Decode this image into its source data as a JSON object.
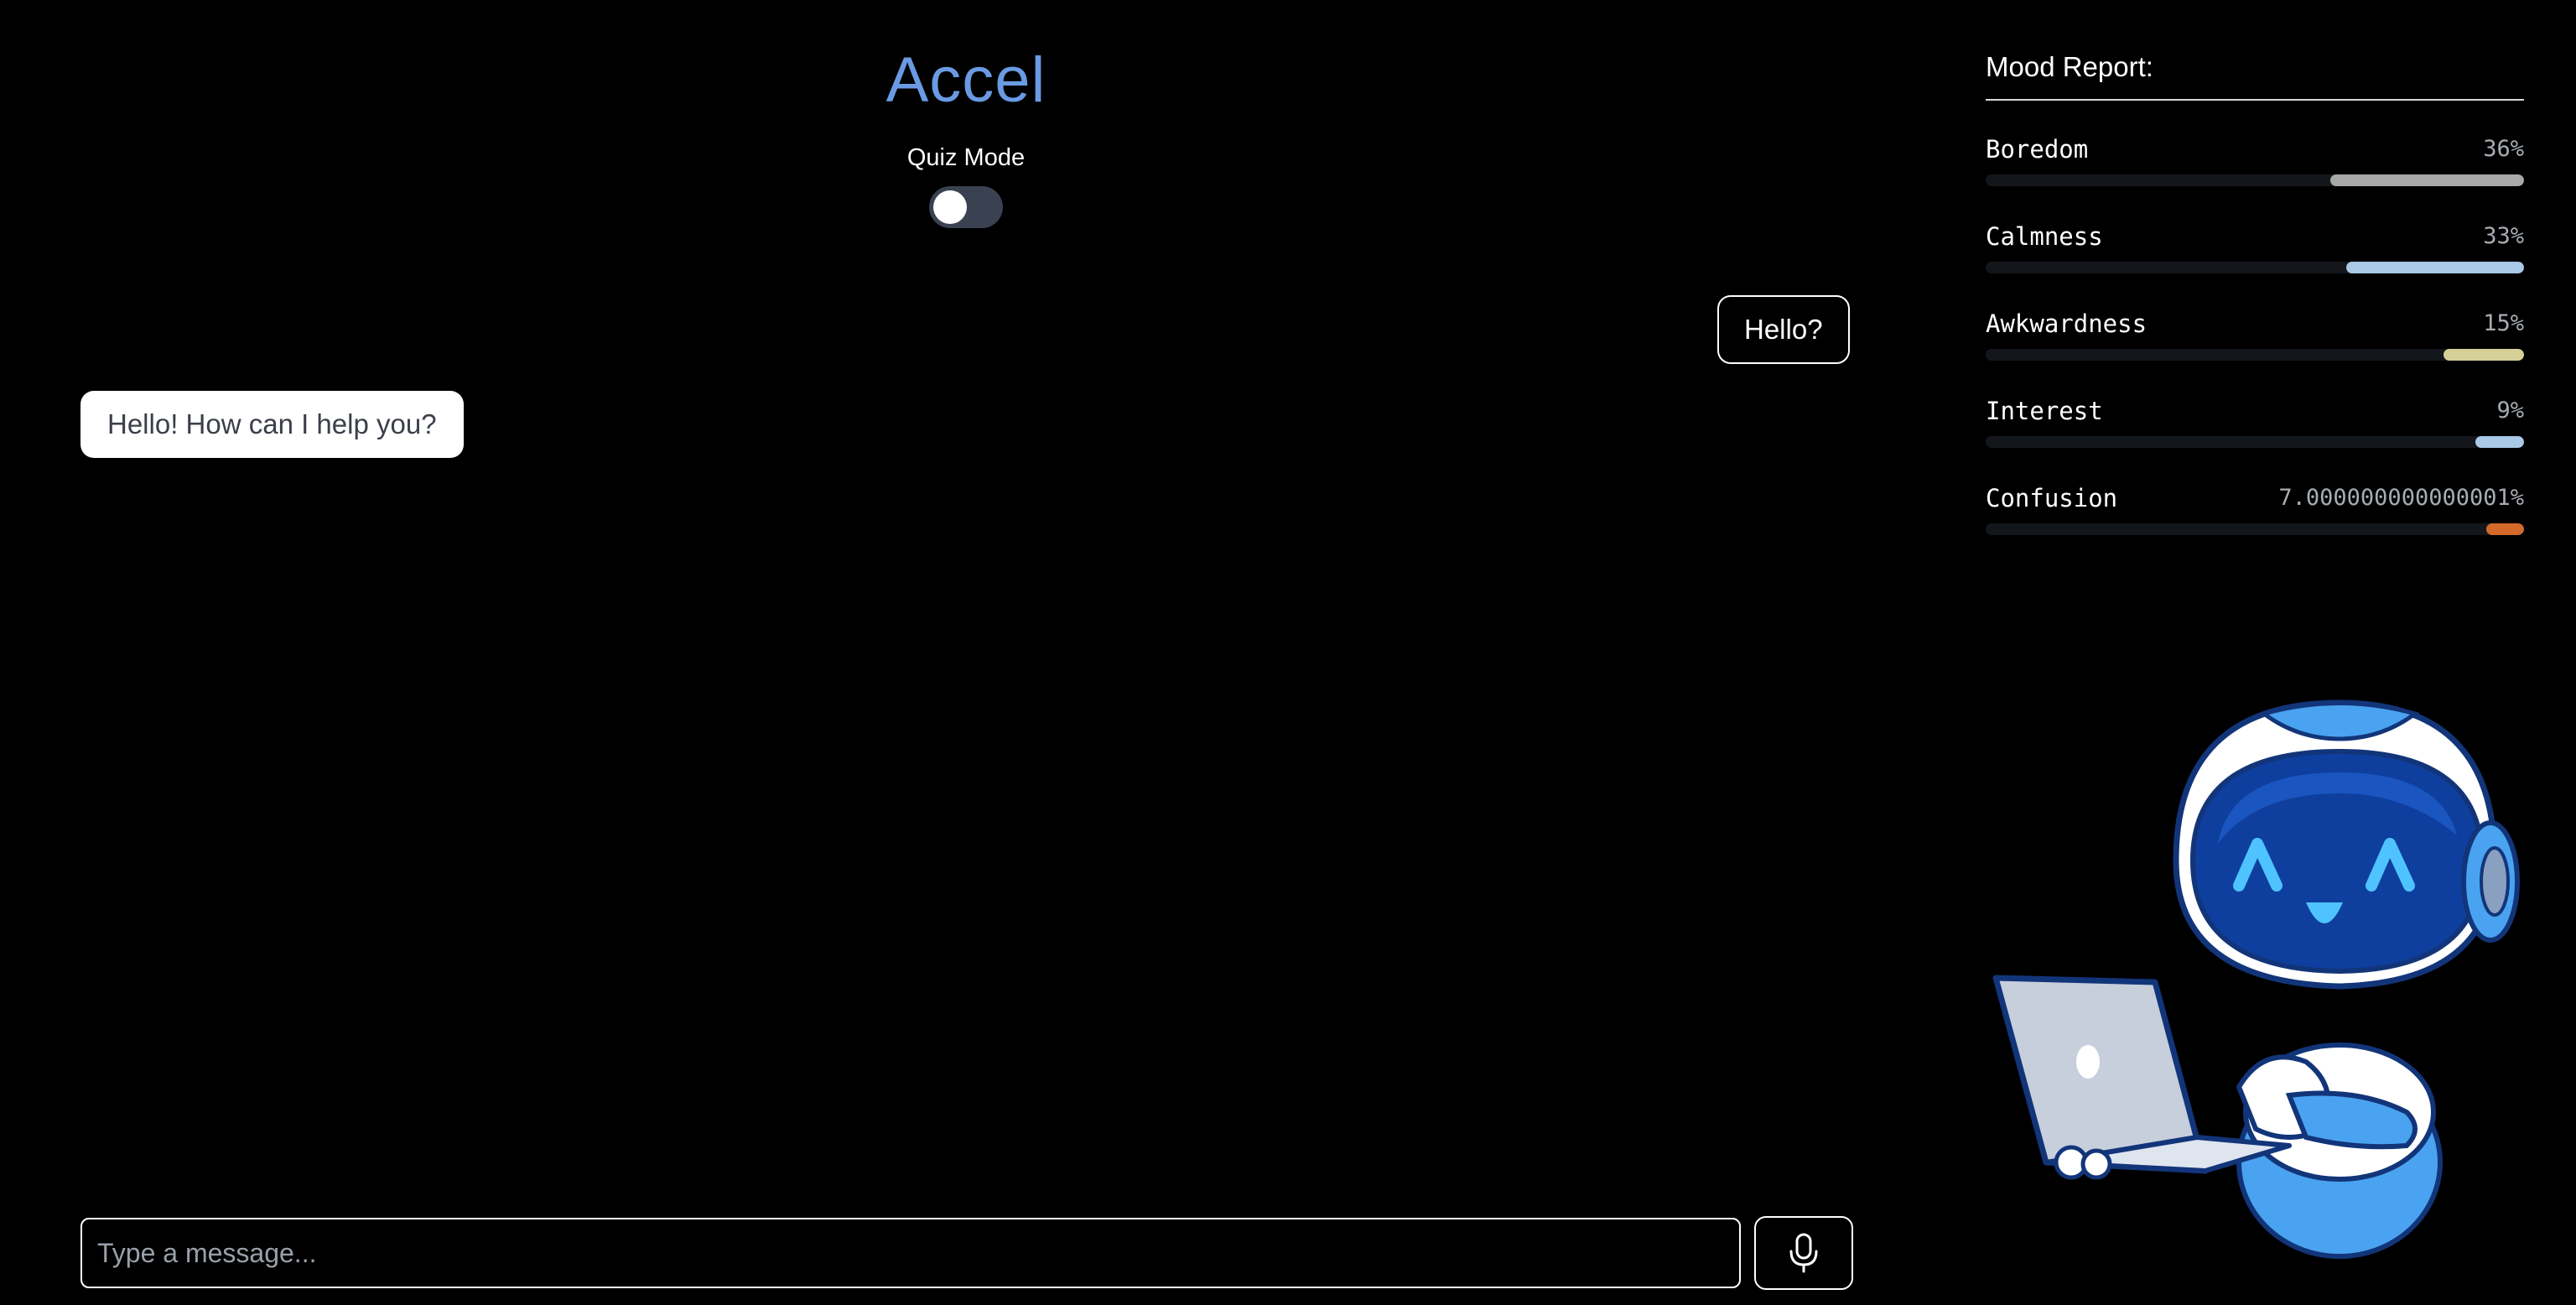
{
  "header": {
    "title": "Accel",
    "quiz_mode_label": "Quiz Mode",
    "quiz_mode_on": false
  },
  "chat": {
    "messages": [
      {
        "role": "user",
        "text": "Hello?"
      },
      {
        "role": "assistant",
        "text": "Hello! How can I help you?"
      }
    ],
    "input_placeholder": "Type a message...",
    "input_value": "",
    "mic_icon": "microphone-icon"
  },
  "mood": {
    "title": "Mood Report:",
    "items": [
      {
        "name": "Boredom",
        "value_text": "36%",
        "percent": 36,
        "color": "#a8a8a8"
      },
      {
        "name": "Calmness",
        "value_text": "33%",
        "percent": 33,
        "color": "#a9c9e6"
      },
      {
        "name": "Awkwardness",
        "value_text": "15%",
        "percent": 15,
        "color": "#d4d097"
      },
      {
        "name": "Interest",
        "value_text": "9%",
        "percent": 9,
        "color": "#a9c9e6"
      },
      {
        "name": "Confusion",
        "value_text": "7.000000000000001%",
        "percent": 7,
        "color": "#d36a2b"
      }
    ]
  },
  "colors": {
    "background": "#000000",
    "accent": "#6a9ae3",
    "toggle_off": "#3a4252"
  },
  "mascot_icon": "robot-with-laptop-mascot"
}
